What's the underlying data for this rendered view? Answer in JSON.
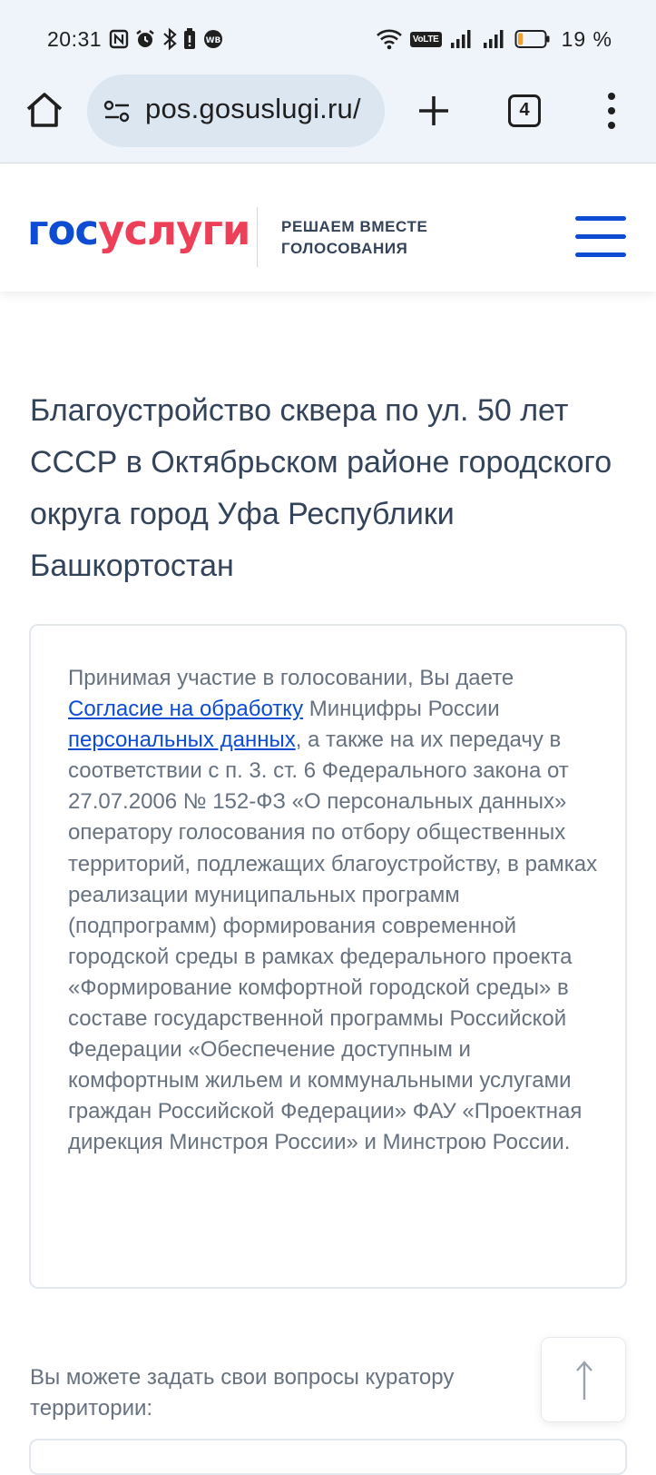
{
  "status_bar": {
    "time": "20:31",
    "battery_percent": "19 %",
    "battery_level": 0.19,
    "volte_label": "VoLTE",
    "icons": [
      "nfc-icon",
      "alarm-icon",
      "bluetooth-icon",
      "battery-saver-icon",
      "wb-icon",
      "wifi-icon",
      "signal-sim1-icon",
      "signal-sim2-icon",
      "battery-icon"
    ]
  },
  "browser": {
    "url": "pos.gosuslugi.ru/",
    "tab_count": "4",
    "icons": [
      "home-icon",
      "site-settings-icon",
      "plus-icon",
      "more-vert-icon"
    ]
  },
  "header": {
    "logo_part1": "гос",
    "logo_part2": "услуги",
    "tagline_line1": "РЕШАЕМ ВМЕСТЕ",
    "tagline_line2": "ГОЛОСОВАНИЯ",
    "colors": {
      "brand_blue": "#0d4cd3",
      "brand_red": "#ee3f58"
    }
  },
  "main": {
    "title": "Благоустройство сквера по ул. 50 лет СССР в Октябрьском районе городского округа город Уфа Республики Башкортостан",
    "consent": {
      "text_before": "Принимая участие в голосовании, Вы даете ",
      "link_label": "Согласие на обработку",
      "text_middle": " Минцифры России ",
      "link_label_2": "персональных данных",
      "text_after": ", а также на их передачу в соответствии с п. 3. ст. 6 Федерального закона от 27.07.2006 № 152-ФЗ «О персональных данных» оператору голосования по отбору общественных территорий, подлежащих благоустройству, в рамках реализации муниципальных программ (подпрограмм) формирования современной городской среды в рамках федерального проекта «Формирование комфортной городской среды» в составе государственной программы Российской Федерации «Обеспечение доступным и комфортным жильем и коммунальными услугами граждан Российской Федерации» ФАУ «Проектная дирекция Минстроя России» и Минстрою России."
    },
    "questions_text": "Вы можете задать свои вопросы куратору территории:"
  }
}
